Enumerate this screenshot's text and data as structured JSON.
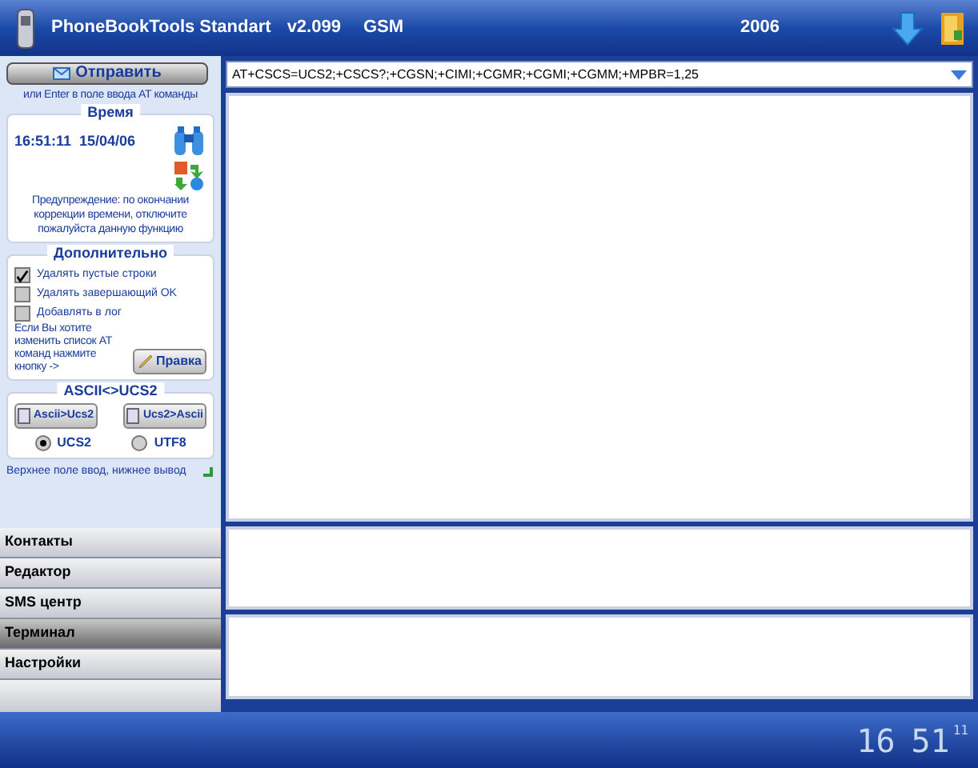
{
  "header": {
    "title": "PhoneBookTools Standart",
    "version": "v2.099",
    "mode": "GSM",
    "year": "2006"
  },
  "send": {
    "button": "Отправить",
    "hint": "или Enter  в поле ввода AT команды"
  },
  "time": {
    "legend": "Время",
    "value": "16:51:11  15/04/06",
    "warning": "Предупреждение: по окончании коррекции времени, отключите пожалуйста данную функцию"
  },
  "extra": {
    "legend": "Дополнительно",
    "options": [
      {
        "label": "Удалять пустые строки",
        "checked": true
      },
      {
        "label": "Удалять завершающий OK",
        "checked": false
      },
      {
        "label": "Добавлять в лог",
        "checked": false
      }
    ],
    "edit_hint": "Если Вы хотите изменить список AT команд нажмите кнопку ->",
    "edit_button": "Правка"
  },
  "convert": {
    "legend": "ASCII<>UCS2",
    "buttons": [
      "Ascii>Ucs2",
      "Ucs2>Ascii"
    ],
    "encodings": [
      {
        "label": "UCS2",
        "selected": true
      },
      {
        "label": "UTF8",
        "selected": false
      }
    ],
    "note": "Верхнее поле ввод, нижнее вывод"
  },
  "nav": [
    {
      "label": "Контакты",
      "selected": false
    },
    {
      "label": "Редактор",
      "selected": false
    },
    {
      "label": "SMS центр",
      "selected": false
    },
    {
      "label": "Терминал",
      "selected": true
    },
    {
      "label": "Настройки",
      "selected": false
    }
  ],
  "command": {
    "value": "AT+CSCS=UCS2;+CSCS?;+CGSN;+CIMI;+CGMR;+CGMI;+CGMM;+MPBR=1,25"
  },
  "clock": {
    "hours": "16",
    "minutes": "51",
    "seconds": "11"
  }
}
